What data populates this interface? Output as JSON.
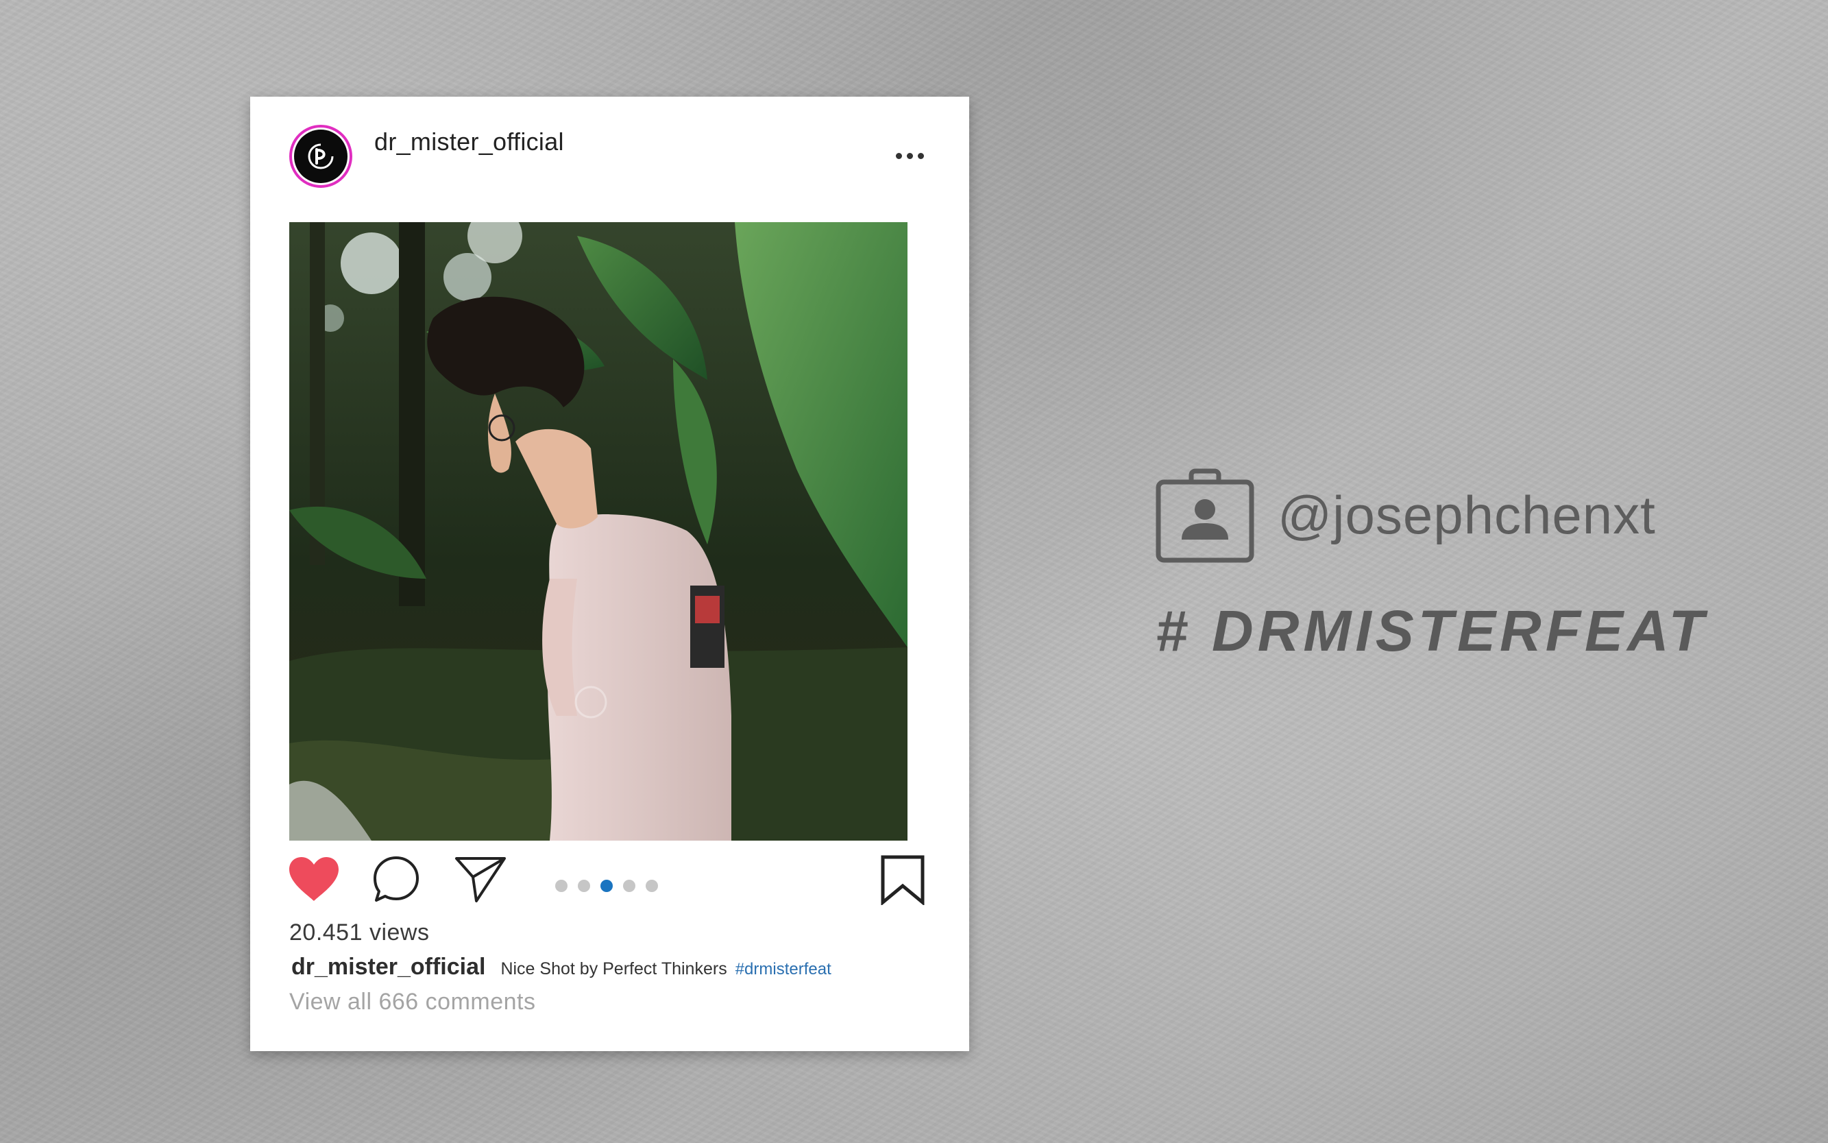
{
  "post": {
    "username": "dr_mister_official",
    "location": "",
    "views": "20.451 views",
    "caption": {
      "username": "dr_mister_official",
      "text": "Nice Shot by Perfect Thinkers",
      "hashtag": "#drmisterfeat"
    },
    "view_comments": "View all 666 comments",
    "carousel": {
      "total": 5,
      "active_index": 2
    },
    "liked": true
  },
  "overlay": {
    "handle": "@josephchenxt",
    "hashtag": "# DRMISTERFEAT"
  },
  "colors": {
    "avatar_ring": "#e02ec0",
    "like_red": "#ee4b5c",
    "active_dot": "#1a74c0",
    "hashtag_link": "#2a6fb0",
    "overlay_text": "#5d5d5d"
  },
  "icons": {
    "more": "ellipsis-icon",
    "like": "heart-icon",
    "comment": "comment-icon",
    "share": "paper-plane-icon",
    "save": "bookmark-icon",
    "profile_badge": "id-badge-icon"
  }
}
